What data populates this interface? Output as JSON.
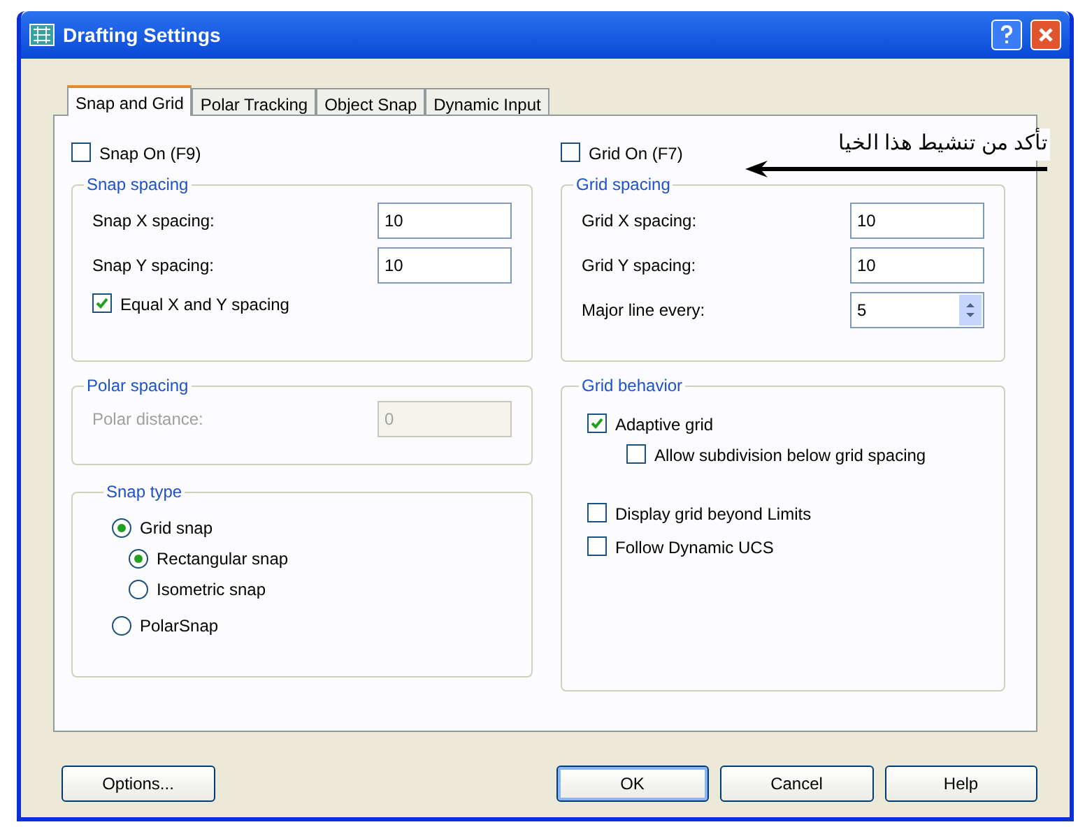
{
  "window": {
    "title": "Drafting Settings"
  },
  "tabs": [
    {
      "label": "Snap and Grid",
      "selected": true
    },
    {
      "label": "Polar Tracking",
      "selected": false
    },
    {
      "label": "Object Snap",
      "selected": false
    },
    {
      "label": "Dynamic Input",
      "selected": false
    }
  ],
  "snap_on": {
    "label": "Snap On (F9)",
    "checked": false
  },
  "grid_on": {
    "label": "Grid On (F7)",
    "checked": false
  },
  "annotation": {
    "text": "تأكد من تنشيط هذا الخيا"
  },
  "snap_spacing": {
    "title": "Snap spacing",
    "fields": [
      {
        "label": "Snap X spacing:",
        "value": "10"
      },
      {
        "label": "Snap Y spacing:",
        "value": "10"
      }
    ],
    "equal": {
      "label": "Equal X and Y spacing",
      "checked": true
    }
  },
  "polar_spacing": {
    "title": "Polar spacing",
    "field": {
      "label": "Polar distance:",
      "value": "0",
      "disabled": true
    }
  },
  "snap_type": {
    "title": "Snap type",
    "options": [
      {
        "label": "Grid snap",
        "selected": true,
        "children": [
          {
            "label": "Rectangular snap",
            "selected": true
          },
          {
            "label": "Isometric snap",
            "selected": false
          }
        ]
      },
      {
        "label": "PolarSnap",
        "selected": false
      }
    ]
  },
  "grid_spacing": {
    "title": "Grid spacing",
    "fields": [
      {
        "label": "Grid X spacing:",
        "value": "10",
        "kind": "text"
      },
      {
        "label": "Grid Y spacing:",
        "value": "10",
        "kind": "text"
      },
      {
        "label": "Major line every:",
        "value": "5",
        "kind": "spinner"
      }
    ]
  },
  "grid_behavior": {
    "title": "Grid behavior",
    "options": [
      {
        "label": "Adaptive grid",
        "checked": true,
        "children": [
          {
            "label": "Allow subdivision below grid spacing",
            "checked": false
          }
        ]
      },
      {
        "label": "Display grid beyond Limits",
        "checked": false
      },
      {
        "label": "Follow Dynamic UCS",
        "checked": false
      }
    ]
  },
  "buttons": [
    {
      "label": "Options...",
      "default": false
    },
    {
      "label": "OK",
      "default": true
    },
    {
      "label": "Cancel",
      "default": false
    },
    {
      "label": "Help",
      "default": false
    }
  ]
}
